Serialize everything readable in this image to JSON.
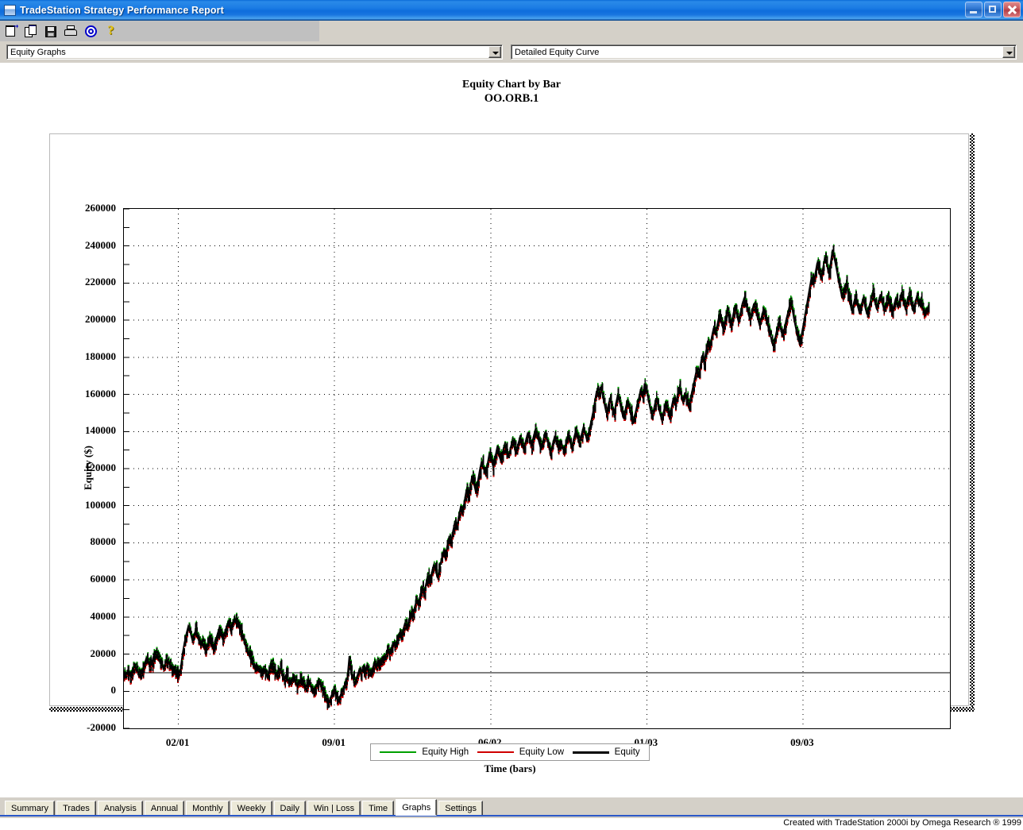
{
  "window": {
    "title": "TradeStation Strategy Performance Report",
    "icon": "window-icon",
    "minimize_label": "",
    "restore_label": "",
    "close_label": ""
  },
  "toolbar": {
    "items": [
      {
        "icon": "report-properties-icon",
        "name": "report-properties-button"
      },
      {
        "icon": "copy-icon",
        "name": "copy-button"
      },
      {
        "icon": "save-icon",
        "name": "save-button"
      },
      {
        "icon": "print-icon",
        "name": "print-button"
      },
      {
        "icon": "target-icon",
        "name": "target-button"
      },
      {
        "icon": "help-icon",
        "name": "help-button",
        "glyph": "?"
      }
    ]
  },
  "selectors": {
    "category": {
      "value": "Equity Graphs",
      "options": [
        "Equity Graphs"
      ]
    },
    "graph": {
      "value": "Detailed Equity Curve",
      "options": [
        "Detailed Equity Curve"
      ]
    }
  },
  "colors": {
    "equity_high": "#00a000",
    "equity_low": "#d00000",
    "equity": "#000000",
    "titlebar": "#1b7ce4",
    "panel": "#d4d0c8",
    "tab_active": "#ffffff"
  },
  "chart_data": {
    "type": "line",
    "title": "Equity Chart by Bar",
    "subtitle": "OO.ORB.1",
    "xlabel": "Time (bars)",
    "ylabel": "Equity ($)",
    "ylim": [
      -20000,
      260000
    ],
    "ytick_step": 20000,
    "yminor_step": 10000,
    "grid": true,
    "legend_position": "bottom",
    "reference_line": 10000,
    "yticks": [
      260000,
      240000,
      220000,
      200000,
      180000,
      160000,
      140000,
      120000,
      100000,
      80000,
      60000,
      40000,
      20000,
      0,
      -20000
    ],
    "xticks": [
      "02/01",
      "09/01",
      "06/02",
      "01/03",
      "09/03"
    ],
    "xtick_positions": [
      0.066,
      0.255,
      0.444,
      0.633,
      0.822
    ],
    "series": [
      {
        "name": "Equity High",
        "color": "#00a000"
      },
      {
        "name": "Equity Low",
        "color": "#d00000"
      },
      {
        "name": "Equity",
        "color": "#000000"
      }
    ],
    "equity_close": [
      9600,
      10200,
      8900,
      7800,
      11000,
      13500,
      12000,
      9800,
      8200,
      10500,
      14000,
      17500,
      16000,
      13800,
      15500,
      19000,
      21000,
      18500,
      16200,
      14000,
      12500,
      14800,
      17000,
      15200,
      13000,
      11500,
      13200,
      8500,
      9500,
      12000,
      20000,
      26000,
      31000,
      35000,
      32000,
      28000,
      30500,
      33000,
      29000,
      25500,
      27000,
      24000,
      22000,
      25000,
      28500,
      26000,
      23500,
      26500,
      30000,
      33500,
      31000,
      28000,
      31500,
      35000,
      37500,
      34000,
      36500,
      39000,
      38000,
      35500,
      33000,
      30000,
      27500,
      24000,
      21000,
      18500,
      16000,
      13500,
      12000,
      14000,
      11500,
      9500,
      12000,
      10500,
      8000,
      11000,
      14000,
      12500,
      10000,
      8500,
      10500,
      12000,
      9000,
      7000,
      8500,
      6000,
      4500,
      6500,
      8000,
      5500,
      3000,
      5000,
      7000,
      4000,
      1500,
      3500,
      5500,
      2000,
      -1000,
      1000,
      3500,
      6000,
      3000,
      500,
      -2000,
      -4500,
      -7000,
      -4000,
      -1500,
      1000,
      -2000,
      -5000,
      -3000,
      -500,
      2000,
      4500,
      7500,
      19000,
      9000,
      6500,
      4000,
      8000,
      11000,
      9500,
      12500,
      10000,
      13500,
      11000,
      9000,
      12000,
      15000,
      13000,
      16500,
      14500,
      18000,
      16000,
      19500,
      22000,
      20000,
      23500,
      26000,
      24000,
      28000,
      31000,
      29000,
      33000,
      36500,
      34000,
      38000,
      42000,
      40000,
      45000,
      49000,
      46500,
      52000,
      56000,
      53000,
      58000,
      62000,
      59500,
      64000,
      68000,
      65500,
      61000,
      66000,
      71000,
      75000,
      72000,
      78000,
      83000,
      80000,
      86000,
      91000,
      88000,
      94000,
      99000,
      96000,
      102000,
      108000,
      104000,
      110000,
      116000,
      112000,
      107000,
      113000,
      119000,
      124000,
      120000,
      117000,
      122000,
      128000,
      125000,
      121000,
      126000,
      131000,
      128000,
      124000,
      129000,
      133000,
      130000,
      126000,
      131000,
      135000,
      132000,
      128000,
      133000,
      137000,
      134000,
      130000,
      135000,
      139000,
      136000,
      132000,
      137000,
      141000,
      138000,
      134000,
      130000,
      135000,
      139000,
      136000,
      132000,
      128000,
      133000,
      137000,
      134000,
      131000,
      135000,
      132000,
      129000,
      134000,
      138000,
      135000,
      131000,
      136000,
      140000,
      137000,
      133000,
      138000,
      142000,
      139000,
      135000,
      140000,
      145000,
      150000,
      156000,
      162000,
      159000,
      164000,
      160000,
      155000,
      150000,
      154000,
      158000,
      153000,
      149000,
      155000,
      160000,
      156000,
      151000,
      147000,
      152000,
      157000,
      153000,
      148000,
      144000,
      149000,
      154000,
      158000,
      163000,
      159000,
      166000,
      162000,
      157000,
      152000,
      148000,
      153000,
      158000,
      154000,
      150000,
      146000,
      151000,
      156000,
      152000,
      148000,
      153000,
      158000,
      154000,
      159000,
      164000,
      160000,
      156000,
      161000,
      157000,
      153000,
      158000,
      163000,
      168000,
      173000,
      169000,
      175000,
      181000,
      177000,
      183000,
      189000,
      185000,
      191000,
      196000,
      192000,
      198000,
      203000,
      199000,
      195000,
      200000,
      205000,
      201000,
      197000,
      202000,
      207000,
      203000,
      199000,
      204000,
      209000,
      212000,
      208000,
      204000,
      200000,
      205000,
      209000,
      205000,
      201000,
      197000,
      202000,
      206000,
      202000,
      198000,
      194000,
      190000,
      186000,
      190000,
      195000,
      199000,
      195000,
      191000,
      196000,
      201000,
      205000,
      210000,
      206000,
      200000,
      195000,
      190000,
      187000,
      193000,
      199000,
      205000,
      211000,
      217000,
      223000,
      219000,
      225000,
      231000,
      227000,
      222000,
      228000,
      234000,
      230000,
      225000,
      231000,
      238000,
      233000,
      228000,
      222000,
      217000,
      212000,
      216000,
      220000,
      215000,
      210000,
      205000,
      209000,
      213000,
      208000,
      204000,
      208000,
      212000,
      207000,
      203000,
      207000,
      211000,
      215000,
      210000,
      206000,
      210000,
      214000,
      209000,
      205000,
      209000,
      213000,
      208000,
      204000,
      208000,
      212000,
      207000,
      211000,
      215000,
      210000,
      206000,
      210000,
      214000,
      209000,
      205000,
      209000,
      213000,
      208000,
      211000,
      207000,
      203000,
      206000,
      204000
    ]
  },
  "tabs": [
    {
      "label": "Summary",
      "active": false
    },
    {
      "label": "Trades",
      "active": false
    },
    {
      "label": "Analysis",
      "active": false
    },
    {
      "label": "Annual",
      "active": false
    },
    {
      "label": "Monthly",
      "active": false
    },
    {
      "label": "Weekly",
      "active": false
    },
    {
      "label": "Daily",
      "active": false
    },
    {
      "label": "Win | Loss",
      "active": false
    },
    {
      "label": "Time",
      "active": false
    },
    {
      "label": "Graphs",
      "active": true
    },
    {
      "label": "Settings",
      "active": false
    }
  ],
  "status": {
    "text": "Created with TradeStation 2000i by Omega Research ® 1999"
  }
}
